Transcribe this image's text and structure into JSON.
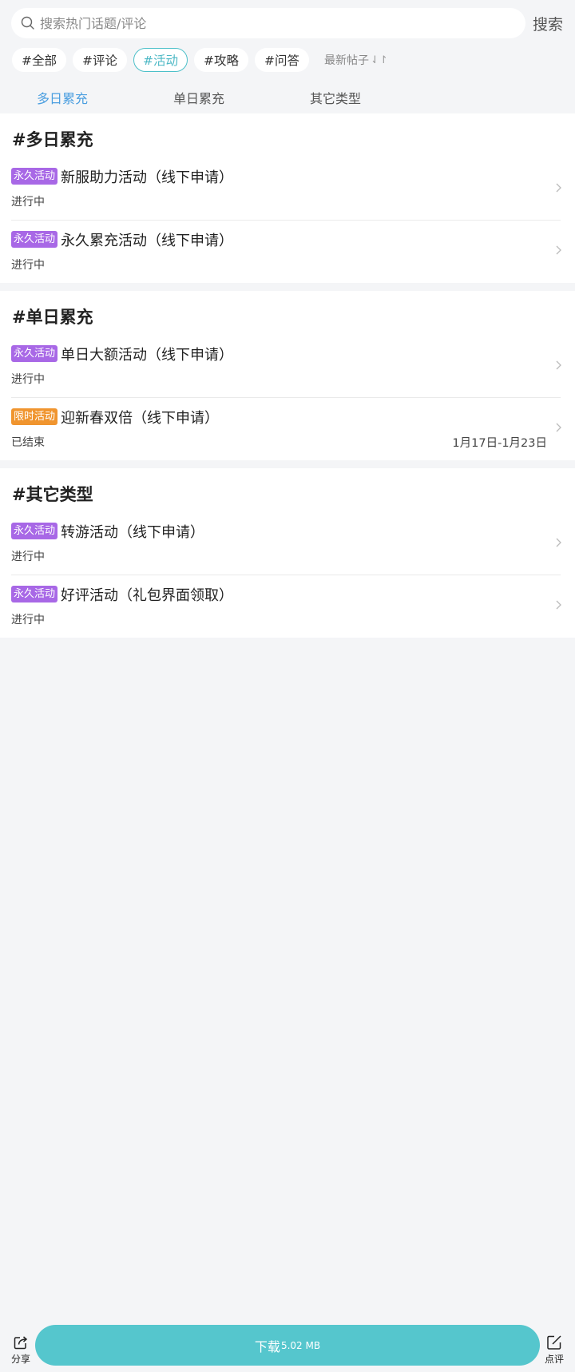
{
  "search": {
    "placeholder": "搜索热门话题/评论",
    "button_label": "搜索"
  },
  "chips": [
    {
      "label": "#全部",
      "active": false
    },
    {
      "label": "#评论",
      "active": false
    },
    {
      "label": "#活动",
      "active": true
    },
    {
      "label": "#攻略",
      "active": false
    },
    {
      "label": "#问答",
      "active": false
    }
  ],
  "sort": {
    "label": "最新帖子",
    "icon": "sort-arrows-icon"
  },
  "tabs": [
    {
      "label": "多日累充",
      "active": true
    },
    {
      "label": "单日累充",
      "active": false
    },
    {
      "label": "其它类型",
      "active": false
    }
  ],
  "sections": [
    {
      "title": "#多日累充",
      "items": [
        {
          "badge": "永久活动",
          "badge_type": "permanent",
          "title": "新服助力活动（线下申请）",
          "status": "进行中",
          "date": ""
        },
        {
          "badge": "永久活动",
          "badge_type": "permanent",
          "title": "永久累充活动（线下申请）",
          "status": "进行中",
          "date": ""
        }
      ]
    },
    {
      "title": "#单日累充",
      "items": [
        {
          "badge": "永久活动",
          "badge_type": "permanent",
          "title": "单日大额活动（线下申请）",
          "status": "进行中",
          "date": ""
        },
        {
          "badge": "限时活动",
          "badge_type": "limited",
          "title": "迎新春双倍（线下申请）",
          "status": "已结束",
          "date": "1月17日-1月23日"
        }
      ]
    },
    {
      "title": "#其它类型",
      "items": [
        {
          "badge": "永久活动",
          "badge_type": "permanent",
          "title": "转游活动（线下申请）",
          "status": "进行中",
          "date": ""
        },
        {
          "badge": "永久活动",
          "badge_type": "permanent",
          "title": "好评活动（礼包界面领取）",
          "status": "进行中",
          "date": ""
        }
      ]
    }
  ],
  "bottom_bar": {
    "share_label": "分享",
    "download_label": "下载",
    "download_size": "5.02 MB",
    "review_label": "点评"
  },
  "colors": {
    "accent_teal": "#55c6cd",
    "tab_active": "#4a9ee0",
    "badge_permanent": "#a868e6",
    "badge_limited": "#f0952f"
  }
}
